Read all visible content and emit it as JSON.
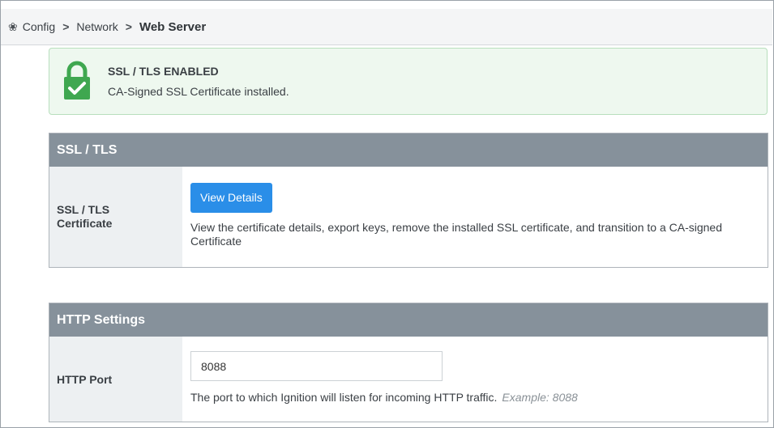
{
  "breadcrumb": {
    "items": [
      "Config",
      "Network"
    ],
    "current": "Web Server",
    "separator": ">"
  },
  "alert": {
    "title": "SSL / TLS ENABLED",
    "message": "CA-Signed SSL Certificate installed."
  },
  "ssl_panel": {
    "header": "SSL / TLS",
    "label": "SSL / TLS Certificate",
    "button_label": "View Details",
    "description": "View the certificate details, export keys, remove the installed SSL certificate, and transition to a CA-signed Certificate"
  },
  "http_panel": {
    "header": "HTTP Settings",
    "label": "HTTP Port",
    "port_value": "8088",
    "description": "The port to which Ignition will listen for incoming HTTP traffic.",
    "example": "Example: 8088"
  },
  "colors": {
    "accent": "#2a8ee8",
    "success": "#3fa750",
    "panel_header": "#86919b"
  },
  "icons": [
    "gear-icon",
    "lock-check-icon"
  ]
}
